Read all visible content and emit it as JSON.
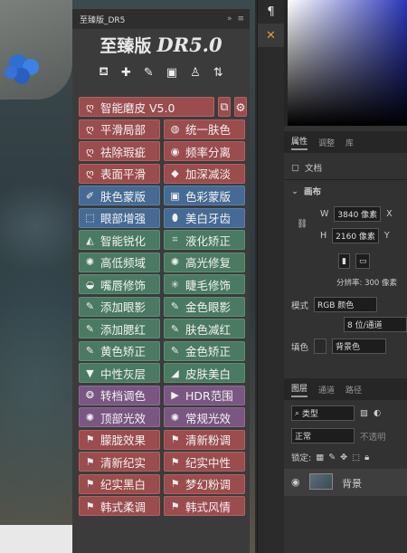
{
  "panel": {
    "tab_label": "至臻版_DR5",
    "title_cn": "至臻版",
    "title_en": "DR5.0",
    "tool_icons": [
      "stamp-icon",
      "bandage-icon",
      "brush-icon",
      "chip-icon",
      "person-icon",
      "user-shift-icon"
    ],
    "rows": [
      [
        {
          "label": "智能磨皮  V5.0",
          "color": "red",
          "icon": "lasso-icon",
          "glyph": "ღ"
        }
      ],
      [
        {
          "label": "平滑局部",
          "color": "red",
          "icon": "lasso-icon",
          "glyph": "ღ"
        },
        {
          "label": "统一肤色",
          "color": "red",
          "icon": "hatch-circle-icon",
          "glyph": "◍"
        }
      ],
      [
        {
          "label": "祛除瑕疵",
          "color": "red",
          "icon": "lasso-icon",
          "glyph": "ღ"
        },
        {
          "label": "频率分离",
          "color": "red",
          "icon": "target-icon",
          "glyph": "◉"
        }
      ],
      [
        {
          "label": "表面平滑",
          "color": "red",
          "icon": "lasso-icon",
          "glyph": "ღ"
        },
        {
          "label": "加深减淡",
          "color": "red",
          "icon": "half-diamond-icon",
          "glyph": "◆"
        }
      ],
      [
        {
          "label": "肤色蒙版",
          "color": "blue",
          "icon": "wand-icon",
          "glyph": "✐"
        },
        {
          "label": "色彩蒙版",
          "color": "blue",
          "icon": "mask-icon",
          "glyph": "▣"
        }
      ],
      [
        {
          "label": "眼部增强",
          "color": "blue",
          "icon": "dotted-rect-icon",
          "glyph": "⬚"
        },
        {
          "label": "美白牙齿",
          "color": "blue",
          "icon": "tooth-icon",
          "glyph": "⬮"
        }
      ],
      [
        {
          "label": "智能锐化",
          "color": "green",
          "icon": "triangle-icon",
          "glyph": "◭"
        },
        {
          "label": "液化矫正",
          "color": "green",
          "icon": "grid-icon",
          "glyph": "⌗"
        }
      ],
      [
        {
          "label": "高低频域",
          "color": "green",
          "icon": "sun-icon",
          "glyph": "✺"
        },
        {
          "label": "高光修复",
          "color": "green",
          "icon": "sun-icon",
          "glyph": "✺"
        }
      ],
      [
        {
          "label": "嘴唇修饰",
          "color": "green",
          "icon": "lips-icon",
          "glyph": "◒"
        },
        {
          "label": "睫毛修饰",
          "color": "green",
          "icon": "sparkle-icon",
          "glyph": "✳"
        }
      ],
      [
        {
          "label": "添加眼影",
          "color": "green",
          "icon": "brush-icon",
          "glyph": "✎"
        },
        {
          "label": "金色眼影",
          "color": "green",
          "icon": "brush-icon",
          "glyph": "✎"
        }
      ],
      [
        {
          "label": "添加腮红",
          "color": "green",
          "icon": "brush-icon",
          "glyph": "✎"
        },
        {
          "label": "肤色减红",
          "color": "green",
          "icon": "brush-icon",
          "glyph": "✎"
        }
      ],
      [
        {
          "label": "黄色矫正",
          "color": "green",
          "icon": "brush-icon",
          "glyph": "✎"
        },
        {
          "label": "金色矫正",
          "color": "green",
          "icon": "brush-icon",
          "glyph": "✎"
        }
      ],
      [
        {
          "label": "中性灰层",
          "color": "green",
          "icon": "down-triangle-icon",
          "glyph": "▼"
        },
        {
          "label": "皮肤美白",
          "color": "green",
          "icon": "up-triangle-icon",
          "glyph": "◢"
        }
      ],
      [
        {
          "label": "转档调色",
          "color": "purple",
          "icon": "aperture-icon",
          "glyph": "❂"
        },
        {
          "label": "HDR范围",
          "color": "purple",
          "icon": "play-icon",
          "glyph": "▶"
        }
      ],
      [
        {
          "label": "顶部光效",
          "color": "purple",
          "icon": "sun-icon",
          "glyph": "✺"
        },
        {
          "label": "常规光效",
          "color": "purple",
          "icon": "sun-icon",
          "glyph": "✺"
        }
      ],
      [
        {
          "label": "朦胧效果",
          "color": "red",
          "icon": "flag-icon",
          "glyph": "⚑"
        },
        {
          "label": "清新粉调",
          "color": "red",
          "icon": "flag-icon",
          "glyph": "⚑"
        }
      ],
      [
        {
          "label": "清新纪实",
          "color": "red",
          "icon": "flag-icon",
          "glyph": "⚑"
        },
        {
          "label": "纪实中性",
          "color": "red",
          "icon": "flag-icon",
          "glyph": "⚑"
        }
      ],
      [
        {
          "label": "纪实黑白",
          "color": "red",
          "icon": "flag-icon",
          "glyph": "⚑"
        },
        {
          "label": "梦幻粉调",
          "color": "red",
          "icon": "flag-icon",
          "glyph": "⚑"
        }
      ],
      [
        {
          "label": "韩式柔调",
          "color": "red",
          "icon": "flag-icon",
          "glyph": "⚑"
        },
        {
          "label": "韩式风情",
          "color": "red",
          "icon": "flag-icon",
          "glyph": "⚑"
        }
      ]
    ]
  },
  "properties": {
    "tabs": [
      "属性",
      "调整",
      "库"
    ],
    "doc_label": "文档",
    "canvas_label": "画布",
    "w_label": "W",
    "w_value": "3840 像素",
    "x_label": "X",
    "h_label": "H",
    "h_value": "2160 像素",
    "y_label": "Y",
    "resolution": "分辨率: 300 像素",
    "mode_label": "模式",
    "mode_value": "RGB 颜色",
    "depth_value": "8 位/通道",
    "fill_label": "填色",
    "fill_value": "背景色"
  },
  "layers": {
    "tabs": [
      "图层",
      "通道",
      "路径"
    ],
    "filter_value": "类型",
    "blend_value": "正常",
    "opacity_label": "不透明",
    "lock_label": "锁定:",
    "layer_name": "背景"
  },
  "colors": {
    "red": "#9b4c4d",
    "blue": "#456b94",
    "green": "#4a7a62",
    "purple": "#7a5682"
  }
}
